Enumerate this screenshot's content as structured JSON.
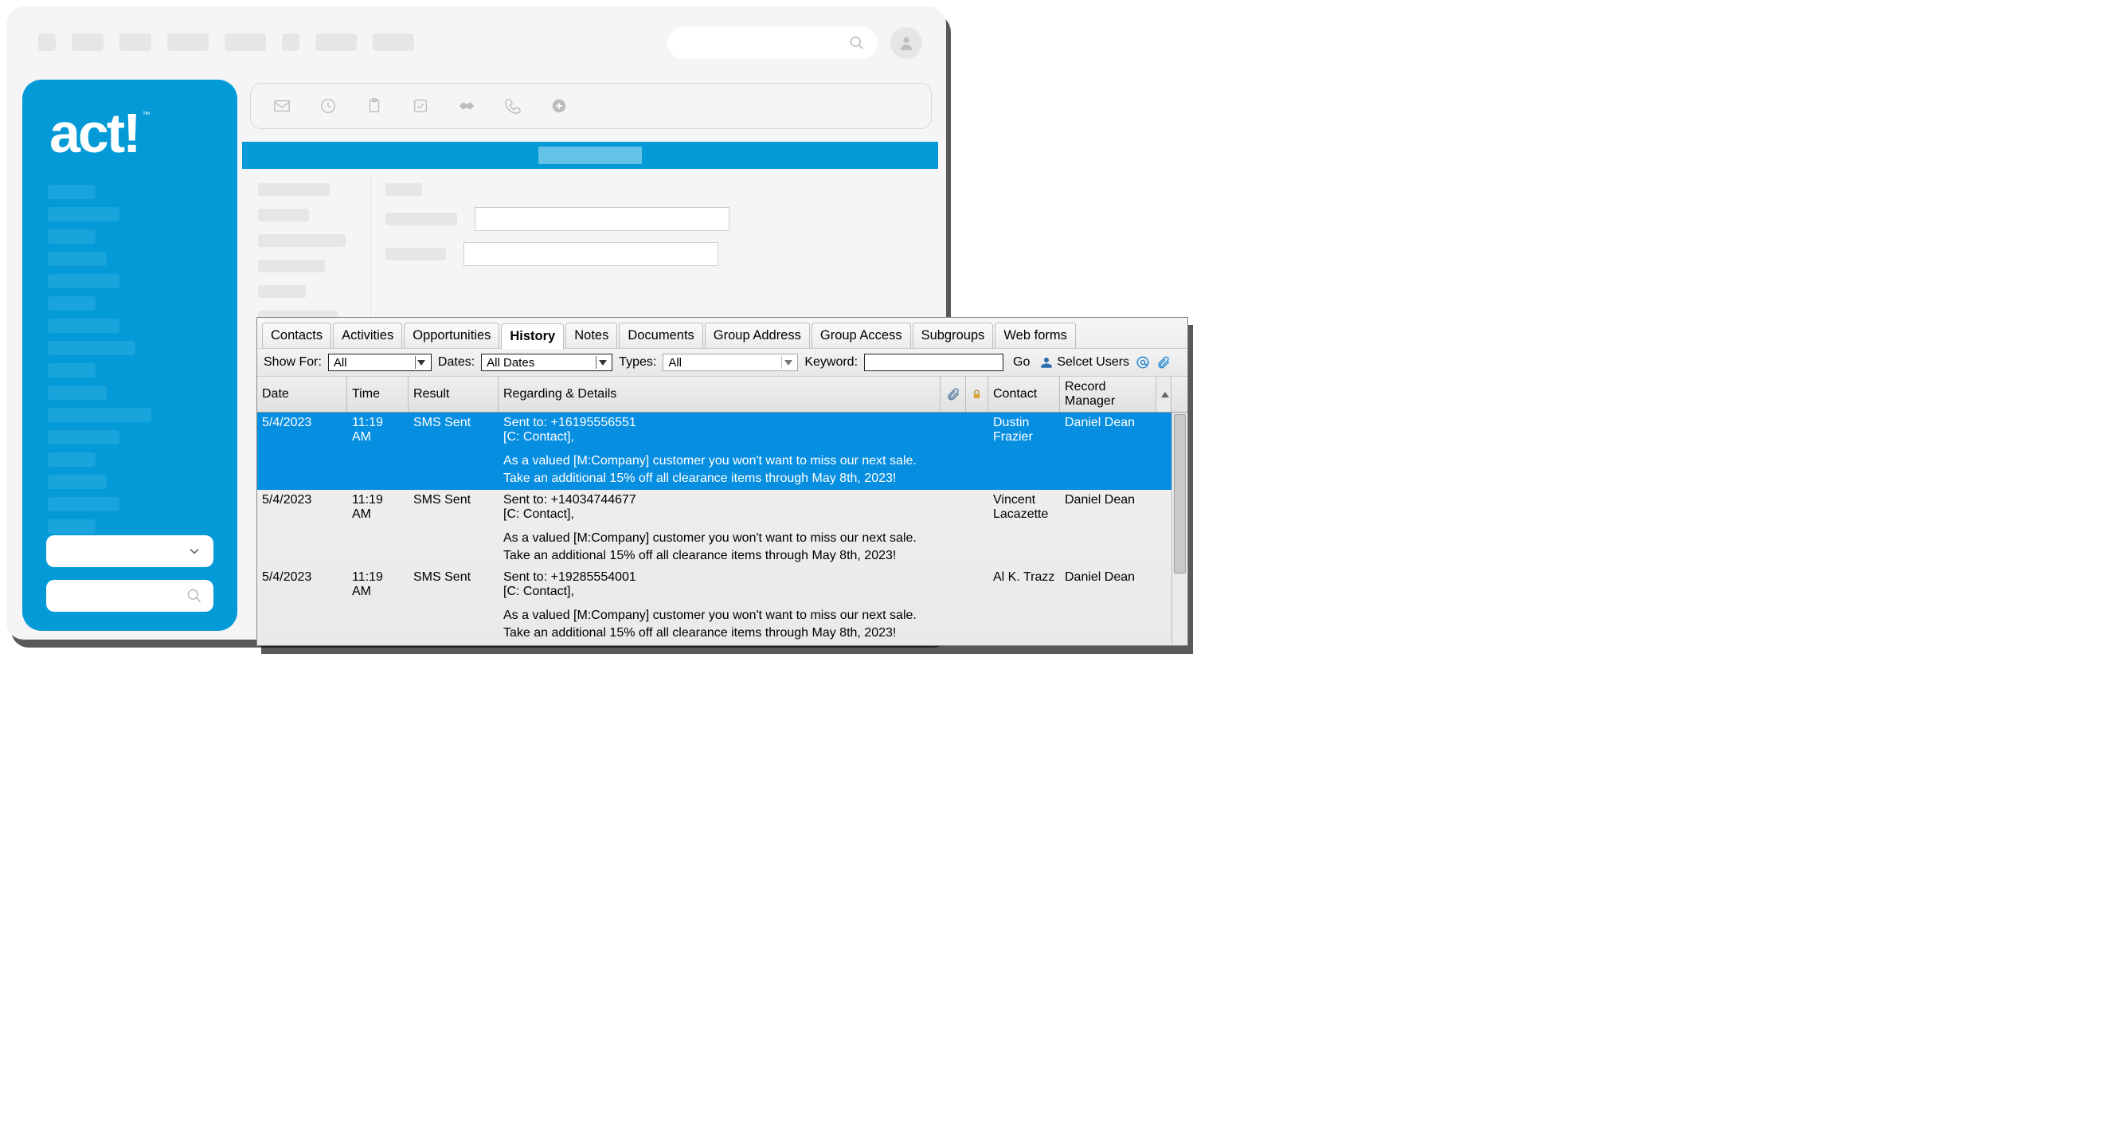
{
  "app": {
    "logo_text": "act!",
    "logo_tm": "™"
  },
  "tabs": {
    "items": [
      {
        "label": "Contacts"
      },
      {
        "label": "Activities"
      },
      {
        "label": "Opportunities"
      },
      {
        "label": "History"
      },
      {
        "label": "Notes"
      },
      {
        "label": "Documents"
      },
      {
        "label": "Group Address"
      },
      {
        "label": "Group Access"
      },
      {
        "label": "Subgroups"
      },
      {
        "label": "Web forms"
      }
    ],
    "active_index": 3
  },
  "filter": {
    "show_for_label": "Show For:",
    "show_for_value": "All",
    "dates_label": "Dates:",
    "dates_value": "All Dates",
    "types_label": "Types:",
    "types_value": "All",
    "keyword_label": "Keyword:",
    "keyword_value": "",
    "go_label": "Go",
    "select_users_label": "Selcet Users"
  },
  "columns": {
    "date": "Date",
    "time": "Time",
    "result": "Result",
    "details": "Regarding & Details",
    "contact": "Contact",
    "record_manager": "Record Manager"
  },
  "rows": [
    {
      "date": "5/4/2023",
      "time": "11:19 AM",
      "result": "SMS Sent",
      "line1": "Sent to: +16195556551",
      "line2": "[C: Contact],",
      "body": "As a valued [M:Company] customer you won't want to miss our next sale. Take an additional 15% off all clearance items through May 8th, 2023!",
      "contact": "Dustin Frazier",
      "record_manager": "Daniel Dean",
      "selected": true
    },
    {
      "date": "5/4/2023",
      "time": "11:19 AM",
      "result": "SMS Sent",
      "line1": "Sent to: +14034744677",
      "line2": "[C: Contact],",
      "body": "As a valued [M:Company] customer you won't want to miss our next sale. Take an additional 15% off all clearance items through May 8th, 2023!",
      "contact": "Vincent Lacazette",
      "record_manager": "Daniel Dean",
      "selected": false
    },
    {
      "date": "5/4/2023",
      "time": "11:19 AM",
      "result": "SMS Sent",
      "line1": "Sent to: +19285554001",
      "line2": "[C: Contact],",
      "body": "As a valued [M:Company] customer you won't want to miss our next sale. Take an additional 15% off all clearance items through May 8th, 2023!",
      "contact": "Al K. Trazz",
      "record_manager": "Daniel Dean",
      "selected": false
    }
  ]
}
